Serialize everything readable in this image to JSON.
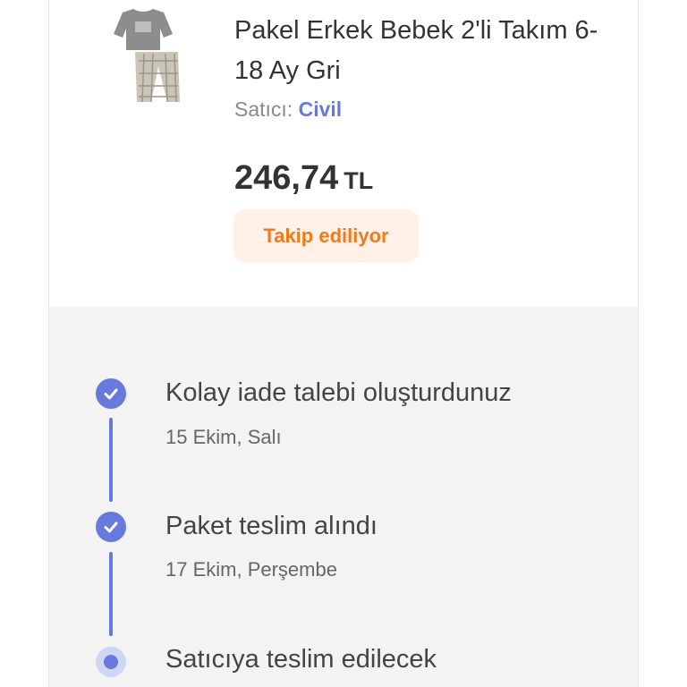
{
  "product": {
    "image_icon": "pajama-set-thumbnail",
    "title": "Pakel Erkek Bebek 2'li Takım 6-18 Ay Gri",
    "seller_label": "Satıcı:",
    "seller_name": "Civil",
    "price_amount": "246,74",
    "price_currency": "TL",
    "follow_label": "Takip ediliyor"
  },
  "timeline": {
    "steps": [
      {
        "title": "Kolay iade talebi oluşturdunuz",
        "date": "15 Ekim, Salı",
        "status": "done",
        "icon": "check-icon"
      },
      {
        "title": "Paket teslim alındı",
        "date": "17 Ekim, Perşembe",
        "status": "done",
        "icon": "check-icon"
      },
      {
        "title": "Satıcıya teslim edilecek",
        "status": "current",
        "icon": "current-dot-icon"
      }
    ]
  },
  "colors": {
    "accent": "#6779dc",
    "orange": "#f27a1a",
    "orange_bg": "#fff1e8",
    "timeline_bg": "#f3f3f3"
  }
}
